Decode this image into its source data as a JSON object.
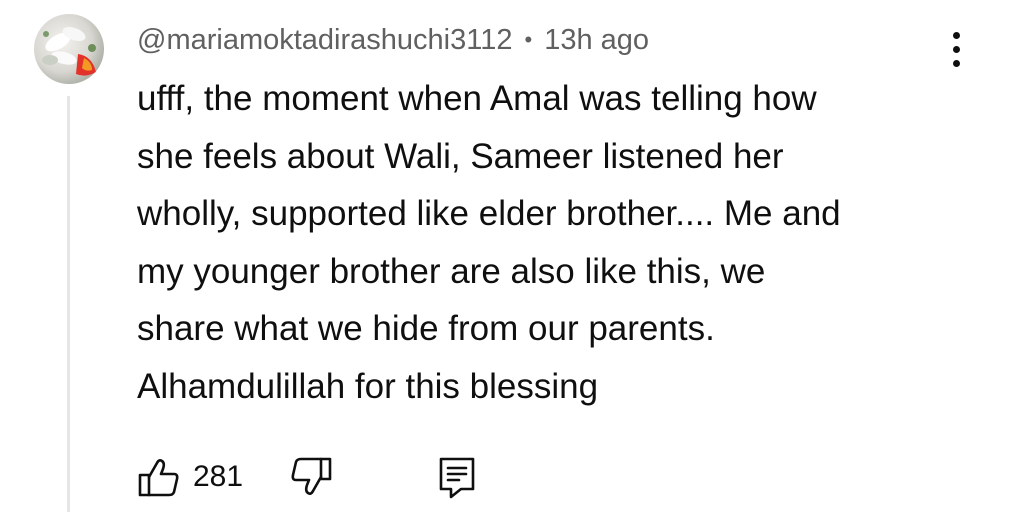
{
  "comment": {
    "author": "@mariamoktadirashuchi3112",
    "separator": "•",
    "time": "13h ago",
    "text_lines": [
      "ufff, the moment when Amal was telling how",
      "she feels about Wali, Sameer listened her",
      "wholly, supported like elder brother.... Me and",
      "my younger brother are also like this, we",
      "share what we hide from our parents.",
      "Alhamdulillah for this blessing"
    ],
    "likes": "281",
    "icons": {
      "like": "thumbs-up-icon",
      "dislike": "thumbs-down-icon",
      "reply": "reply-icon",
      "more": "more-vert-icon"
    }
  }
}
